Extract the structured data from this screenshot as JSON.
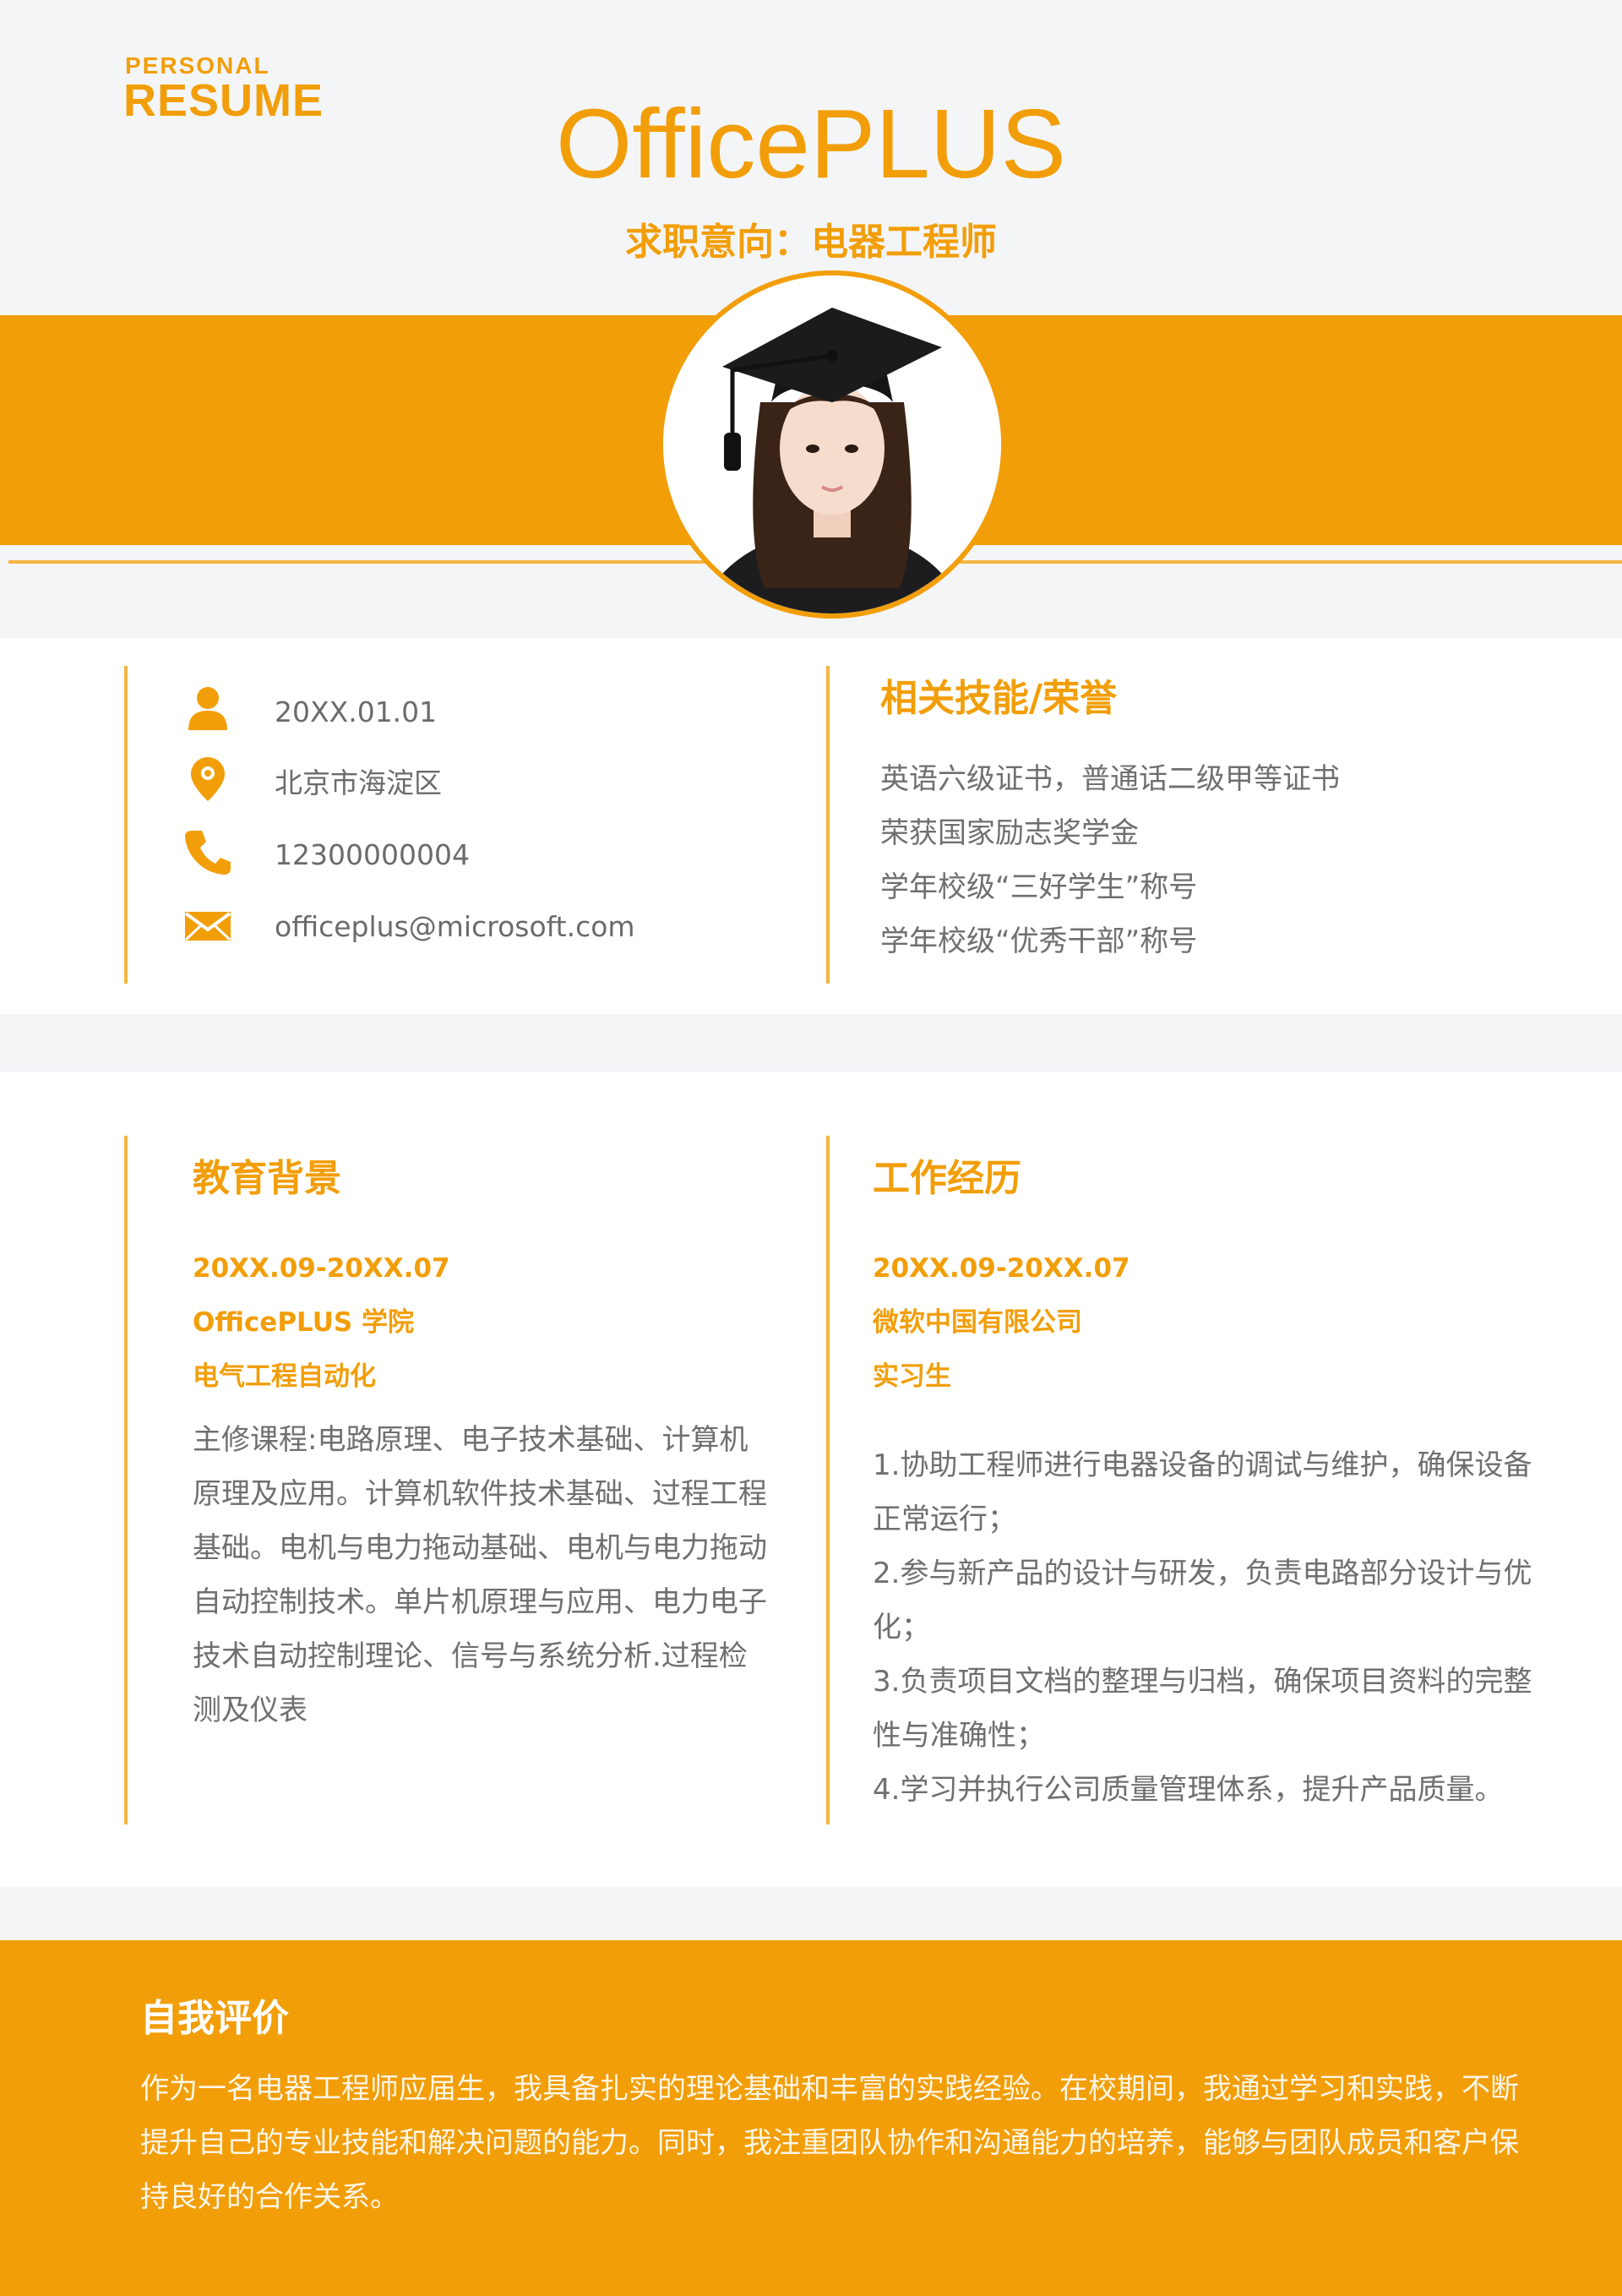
{
  "header": {
    "badge_small": "PERSONAL",
    "badge_big": "RESUME",
    "brand": "OfficePLUS",
    "intent": "求职意向：电器工程师"
  },
  "contact": {
    "birthday": "20XX.01.01",
    "location": "北京市海淀区",
    "phone": "12300000004",
    "email": "officeplus@microsoft.com"
  },
  "skills": {
    "title": "相关技能/荣誉",
    "items": [
      "英语六级证书，普通话二级甲等证书",
      "荣获国家励志奖学金",
      "学年校级“三好学生”称号",
      "学年校级“优秀干部”称号"
    ]
  },
  "education": {
    "title": "教育背景",
    "period": "20XX.09-20XX.07",
    "school": "OfficePLUS 学院",
    "major": "电气工程自动化",
    "description": "主修课程:电路原理、电子技术基础、计算机原理及应用。计算机软件技术基础、过程工程基础。电机与电力拖动基础、电机与电力拖动自动控制技术。单片机原理与应用、电力电子技术自动控制理论、信号与系统分析.过程检测及仪表"
  },
  "work": {
    "title": "工作经历",
    "period": "20XX.09-20XX.07",
    "company": "微软中国有限公司",
    "role": "实习生",
    "duties": [
      "1.协助工程师进行电器设备的调试与维护，确保设备正常运行；",
      "2.参与新产品的设计与研发，负责电路部分设计与优化；",
      "3.负责项目文档的整理与归档，确保项目资料的完整性与准确性；",
      "4.学习并执行公司质量管理体系，提升产品质量。"
    ]
  },
  "self_eval": {
    "title": "自我评价",
    "text": "作为一名电器工程师应届生，我具备扎实的理论基础和丰富的实践经验。在校期间，我通过学习和实践，不断提升自己的专业技能和解决问题的能力。同时，我注重团队协作和沟通能力的培养，能够与团队成员和客户保持良好的合作关系。"
  },
  "icons": {
    "accent": "#f29e09",
    "person": "person-icon",
    "location": "location-pin-icon",
    "phone": "phone-icon",
    "email": "envelope-icon"
  }
}
